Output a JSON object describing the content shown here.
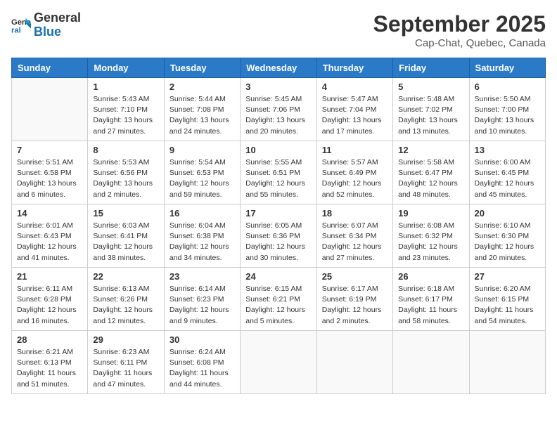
{
  "logo": {
    "line1": "General",
    "line2": "Blue"
  },
  "title": "September 2025",
  "subtitle": "Cap-Chat, Quebec, Canada",
  "days_of_week": [
    "Sunday",
    "Monday",
    "Tuesday",
    "Wednesday",
    "Thursday",
    "Friday",
    "Saturday"
  ],
  "weeks": [
    [
      {
        "day": "",
        "info": ""
      },
      {
        "day": "1",
        "info": "Sunrise: 5:43 AM\nSunset: 7:10 PM\nDaylight: 13 hours and 27 minutes."
      },
      {
        "day": "2",
        "info": "Sunrise: 5:44 AM\nSunset: 7:08 PM\nDaylight: 13 hours and 24 minutes."
      },
      {
        "day": "3",
        "info": "Sunrise: 5:45 AM\nSunset: 7:06 PM\nDaylight: 13 hours and 20 minutes."
      },
      {
        "day": "4",
        "info": "Sunrise: 5:47 AM\nSunset: 7:04 PM\nDaylight: 13 hours and 17 minutes."
      },
      {
        "day": "5",
        "info": "Sunrise: 5:48 AM\nSunset: 7:02 PM\nDaylight: 13 hours and 13 minutes."
      },
      {
        "day": "6",
        "info": "Sunrise: 5:50 AM\nSunset: 7:00 PM\nDaylight: 13 hours and 10 minutes."
      }
    ],
    [
      {
        "day": "7",
        "info": "Sunrise: 5:51 AM\nSunset: 6:58 PM\nDaylight: 13 hours and 6 minutes."
      },
      {
        "day": "8",
        "info": "Sunrise: 5:53 AM\nSunset: 6:56 PM\nDaylight: 13 hours and 2 minutes."
      },
      {
        "day": "9",
        "info": "Sunrise: 5:54 AM\nSunset: 6:53 PM\nDaylight: 12 hours and 59 minutes."
      },
      {
        "day": "10",
        "info": "Sunrise: 5:55 AM\nSunset: 6:51 PM\nDaylight: 12 hours and 55 minutes."
      },
      {
        "day": "11",
        "info": "Sunrise: 5:57 AM\nSunset: 6:49 PM\nDaylight: 12 hours and 52 minutes."
      },
      {
        "day": "12",
        "info": "Sunrise: 5:58 AM\nSunset: 6:47 PM\nDaylight: 12 hours and 48 minutes."
      },
      {
        "day": "13",
        "info": "Sunrise: 6:00 AM\nSunset: 6:45 PM\nDaylight: 12 hours and 45 minutes."
      }
    ],
    [
      {
        "day": "14",
        "info": "Sunrise: 6:01 AM\nSunset: 6:43 PM\nDaylight: 12 hours and 41 minutes."
      },
      {
        "day": "15",
        "info": "Sunrise: 6:03 AM\nSunset: 6:41 PM\nDaylight: 12 hours and 38 minutes."
      },
      {
        "day": "16",
        "info": "Sunrise: 6:04 AM\nSunset: 6:38 PM\nDaylight: 12 hours and 34 minutes."
      },
      {
        "day": "17",
        "info": "Sunrise: 6:05 AM\nSunset: 6:36 PM\nDaylight: 12 hours and 30 minutes."
      },
      {
        "day": "18",
        "info": "Sunrise: 6:07 AM\nSunset: 6:34 PM\nDaylight: 12 hours and 27 minutes."
      },
      {
        "day": "19",
        "info": "Sunrise: 6:08 AM\nSunset: 6:32 PM\nDaylight: 12 hours and 23 minutes."
      },
      {
        "day": "20",
        "info": "Sunrise: 6:10 AM\nSunset: 6:30 PM\nDaylight: 12 hours and 20 minutes."
      }
    ],
    [
      {
        "day": "21",
        "info": "Sunrise: 6:11 AM\nSunset: 6:28 PM\nDaylight: 12 hours and 16 minutes."
      },
      {
        "day": "22",
        "info": "Sunrise: 6:13 AM\nSunset: 6:26 PM\nDaylight: 12 hours and 12 minutes."
      },
      {
        "day": "23",
        "info": "Sunrise: 6:14 AM\nSunset: 6:23 PM\nDaylight: 12 hours and 9 minutes."
      },
      {
        "day": "24",
        "info": "Sunrise: 6:15 AM\nSunset: 6:21 PM\nDaylight: 12 hours and 5 minutes."
      },
      {
        "day": "25",
        "info": "Sunrise: 6:17 AM\nSunset: 6:19 PM\nDaylight: 12 hours and 2 minutes."
      },
      {
        "day": "26",
        "info": "Sunrise: 6:18 AM\nSunset: 6:17 PM\nDaylight: 11 hours and 58 minutes."
      },
      {
        "day": "27",
        "info": "Sunrise: 6:20 AM\nSunset: 6:15 PM\nDaylight: 11 hours and 54 minutes."
      }
    ],
    [
      {
        "day": "28",
        "info": "Sunrise: 6:21 AM\nSunset: 6:13 PM\nDaylight: 11 hours and 51 minutes."
      },
      {
        "day": "29",
        "info": "Sunrise: 6:23 AM\nSunset: 6:11 PM\nDaylight: 11 hours and 47 minutes."
      },
      {
        "day": "30",
        "info": "Sunrise: 6:24 AM\nSunset: 6:08 PM\nDaylight: 11 hours and 44 minutes."
      },
      {
        "day": "",
        "info": ""
      },
      {
        "day": "",
        "info": ""
      },
      {
        "day": "",
        "info": ""
      },
      {
        "day": "",
        "info": ""
      }
    ]
  ]
}
